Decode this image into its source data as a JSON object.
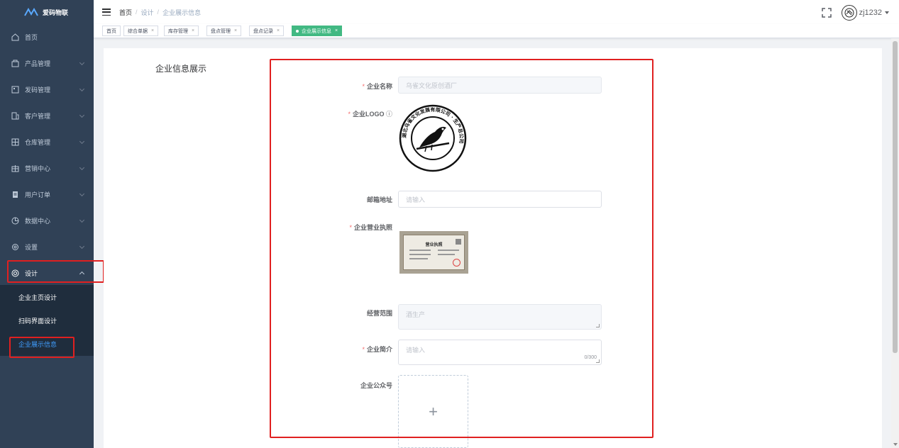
{
  "app": {
    "name": "爱码物联"
  },
  "sidebar": {
    "items": [
      {
        "label": "首页",
        "icon": "home-icon"
      },
      {
        "label": "产品管理",
        "icon": "product-icon"
      },
      {
        "label": "发码管理",
        "icon": "code-icon"
      },
      {
        "label": "客户管理",
        "icon": "customer-icon"
      },
      {
        "label": "仓库管理",
        "icon": "warehouse-icon"
      },
      {
        "label": "营销中心",
        "icon": "marketing-icon"
      },
      {
        "label": "用户订单",
        "icon": "order-icon"
      },
      {
        "label": "数据中心",
        "icon": "data-icon"
      },
      {
        "label": "设置",
        "icon": "settings-icon"
      },
      {
        "label": "设计",
        "icon": "design-icon"
      }
    ],
    "submenu": [
      {
        "label": "企业主页设计"
      },
      {
        "label": "扫码界面设计"
      },
      {
        "label": "企业展示信息"
      }
    ]
  },
  "header": {
    "breadcrumb": [
      "首页",
      "设计",
      "企业展示信息"
    ],
    "user": "zj1232"
  },
  "tags": [
    {
      "label": "首页"
    },
    {
      "label": "综合单据"
    },
    {
      "label": "库存管理"
    },
    {
      "label": "盘点管理"
    },
    {
      "label": "盘点记录"
    },
    {
      "label": "企业展示信息"
    }
  ],
  "main": {
    "section_title": "企业信息展示",
    "form": {
      "company_name": {
        "label": "企业名称",
        "value": "乌雀文化原创酒厂"
      },
      "logo": {
        "label": "企业LOGO",
        "seal_text": "湖北乌雀文化发展有限公司 · 生产总公司"
      },
      "email": {
        "label": "邮箱地址",
        "placeholder": "请输入"
      },
      "license": {
        "label": "企业营业执照",
        "title": "营业执照"
      },
      "scope": {
        "label": "经营范围",
        "value": "酒生产"
      },
      "intro": {
        "label": "企业简介",
        "placeholder": "请输入",
        "count": "0/300"
      },
      "wechat": {
        "label": "企业公众号"
      }
    }
  },
  "colors": {
    "sidebar_bg": "#304156",
    "active": "#409eff",
    "tag_active": "#42b983",
    "highlight": "#e02020"
  }
}
